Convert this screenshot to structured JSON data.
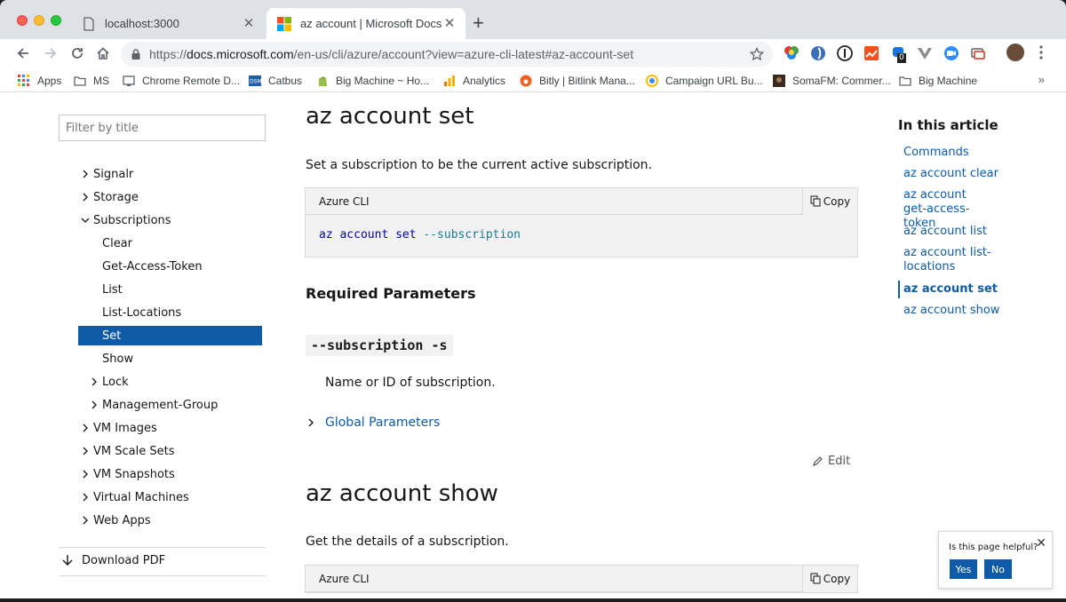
{
  "browser": {
    "tabs": [
      {
        "title": "localhost:3000",
        "active": false
      },
      {
        "title": "az account | Microsoft Docs",
        "active": true
      }
    ],
    "url": {
      "scheme": "https://",
      "host": "docs.microsoft.com",
      "path": "/en-us/cli/azure/account?view=azure-cli-latest#az-account-set"
    },
    "bookmarks": [
      {
        "label": "Apps",
        "icon": "apps-grid-icon"
      },
      {
        "label": "MS",
        "icon": "folder-icon"
      },
      {
        "label": "Chrome Remote D...",
        "icon": "remote-desktop-icon"
      },
      {
        "label": "Catbus",
        "icon": "dsm-icon"
      },
      {
        "label": "Big Machine ~ Ho...",
        "icon": "shopify-icon"
      },
      {
        "label": "Analytics",
        "icon": "analytics-icon"
      },
      {
        "label": "Bitly | Bitlink Mana...",
        "icon": "bitly-icon"
      },
      {
        "label": "Campaign URL Bu...",
        "icon": "campaign-icon"
      },
      {
        "label": "SomaFM: Commer...",
        "icon": "somafm-icon"
      },
      {
        "label": "Big Machine",
        "icon": "folder-icon"
      }
    ],
    "more_bookmarks": "»",
    "extension_badge": "0"
  },
  "sidebar": {
    "filter_placeholder": "Filter by title",
    "items": [
      {
        "label": "Signalr",
        "expanded": false
      },
      {
        "label": "Storage",
        "expanded": false
      },
      {
        "label": "Subscriptions",
        "expanded": true
      },
      {
        "label": "Clear"
      },
      {
        "label": "Get-Access-Token"
      },
      {
        "label": "List"
      },
      {
        "label": "List-Locations"
      },
      {
        "label": "Set",
        "selected": true
      },
      {
        "label": "Show"
      },
      {
        "label": "Lock",
        "expanded": false
      },
      {
        "label": "Management-Group",
        "expanded": false
      },
      {
        "label": "VM Images",
        "expanded": false
      },
      {
        "label": "VM Scale Sets",
        "expanded": false
      },
      {
        "label": "VM Snapshots",
        "expanded": false
      },
      {
        "label": "Virtual Machines",
        "expanded": false
      },
      {
        "label": "Web Apps",
        "expanded": false
      }
    ],
    "download_pdf": "Download PDF"
  },
  "main": {
    "set": {
      "heading": "az account set",
      "description": "Set a subscription to be the current active subscription.",
      "code_lang": "Azure CLI",
      "copy_label": "Copy",
      "code_command": "az account set",
      "code_flag": "--subscription",
      "required_heading": "Required Parameters",
      "param_name": "--subscription -s",
      "param_desc": "Name or ID of subscription.",
      "global_params": "Global Parameters",
      "edit_label": "Edit"
    },
    "show": {
      "heading": "az account show",
      "description": "Get the details of a subscription.",
      "code_lang": "Azure CLI",
      "copy_label": "Copy"
    }
  },
  "in_this_article": {
    "title": "In this article",
    "links": [
      "Commands",
      "az account clear",
      "az account get-access-token",
      "az account list",
      "az account list-locations",
      "az account set",
      "az account show"
    ],
    "active_index": 5
  },
  "feedback": {
    "question": "Is this page helpful?",
    "yes": "Yes",
    "no": "No",
    "close": "✕"
  },
  "colors": {
    "accent": "#0f5ba7",
    "selected_bg": "#0f5ba7",
    "code_bg": "#f2f2f2"
  }
}
